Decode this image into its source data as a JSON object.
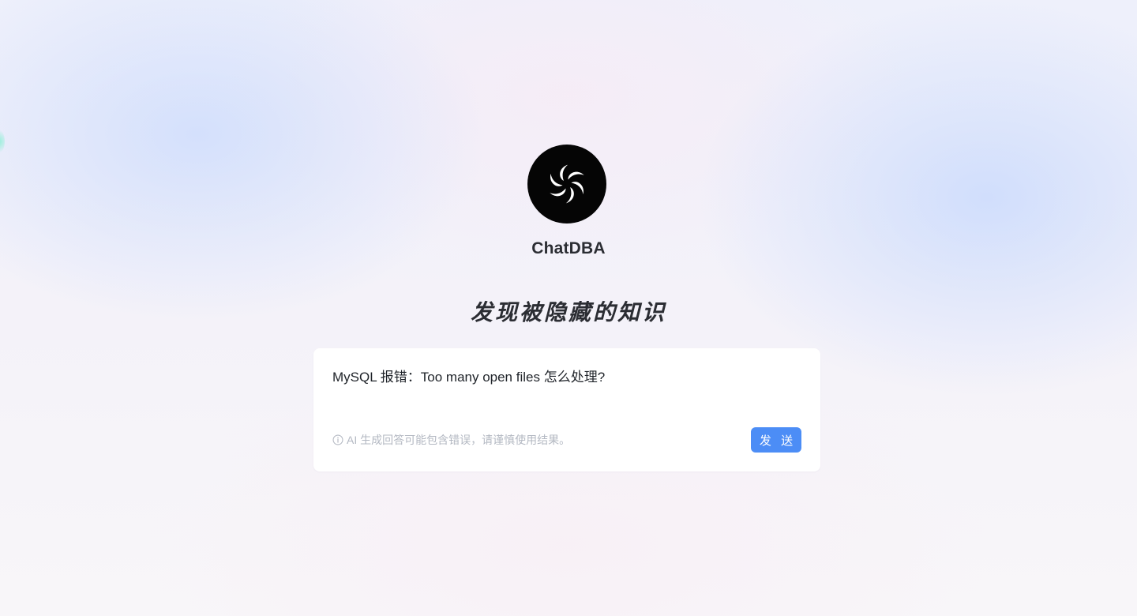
{
  "brand": {
    "name": "ChatDBA",
    "logo_icon": "swirl-logo-icon"
  },
  "hero": {
    "headline": "发现被隐藏的知识"
  },
  "chat": {
    "input_value": "MySQL 报错：Too many open files 怎么处理?",
    "disclaimer": "AI 生成回答可能包含错误，请谨慎使用结果。",
    "disclaimer_icon": "info-circle-icon",
    "send_label": "发 送"
  },
  "colors": {
    "accent": "#4c8df6",
    "logo_background": "#050505",
    "card_background": "#ffffff",
    "muted_text": "#b3b8c2"
  }
}
